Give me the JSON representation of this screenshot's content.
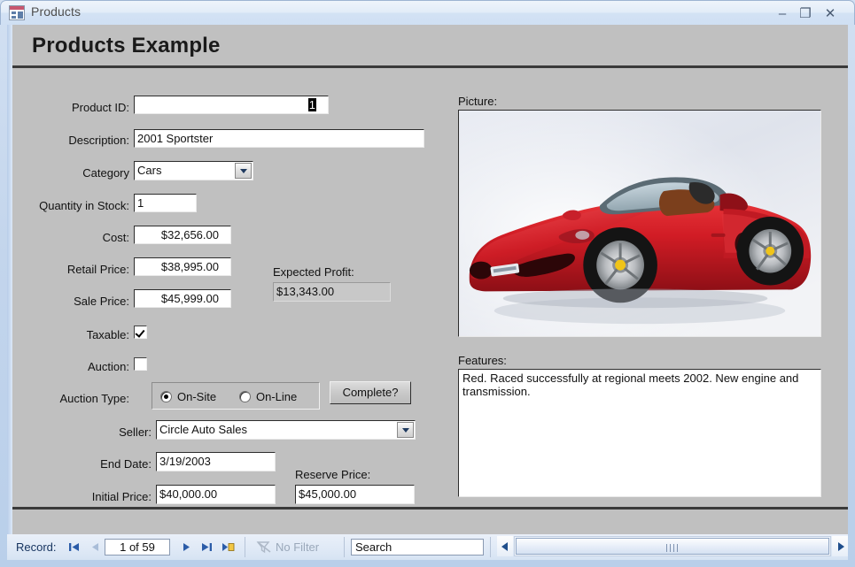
{
  "window": {
    "title": "Products",
    "icon": "access-form-icon",
    "minimize_label": "–",
    "restore_label": "❐",
    "close_label": "✕"
  },
  "form": {
    "header_title": "Products Example",
    "fields": {
      "product_id": {
        "label": "Product ID:",
        "value": "1",
        "selected": true
      },
      "description": {
        "label": "Description:",
        "value": "2001 Sportster"
      },
      "category": {
        "label": "Category",
        "value": "Cars"
      },
      "quantity_in_stock": {
        "label": "Quantity in Stock:",
        "value": "1"
      },
      "cost": {
        "label": "Cost:",
        "value": "$32,656.00"
      },
      "retail_price": {
        "label": "Retail Price:",
        "value": "$38,995.00"
      },
      "sale_price": {
        "label": "Sale Price:",
        "value": "$45,999.00"
      },
      "expected_profit": {
        "label": "Expected Profit:",
        "value": "$13,343.00"
      },
      "taxable": {
        "label": "Taxable:",
        "checked": true
      },
      "auction": {
        "label": "Auction:",
        "checked": false
      },
      "auction_type": {
        "label": "Auction Type:",
        "options": [
          "On-Site",
          "On-Line"
        ],
        "selected": "On-Site"
      },
      "complete_button": {
        "label": "Complete?"
      },
      "seller": {
        "label": "Seller:",
        "value": "Circle Auto Sales"
      },
      "end_date": {
        "label": "End Date:",
        "value": "3/19/2003"
      },
      "initial_price": {
        "label": "Initial Price:",
        "value": "$40,000.00"
      },
      "reserve_price": {
        "label": "Reserve Price:",
        "value": "$45,000.00"
      },
      "picture": {
        "label": "Picture:",
        "alt": "red-convertible-sports-car"
      },
      "features": {
        "label": "Features:",
        "value": "Red. Raced successfully at regional meets 2002. New engine and transmission."
      }
    }
  },
  "navigator": {
    "record_label": "Record:",
    "first_icon": "▮◄",
    "prev_icon": "◄",
    "position": "1 of 59",
    "next_icon": "►",
    "last_icon": "►▮",
    "new_icon": "►✱",
    "filter_label": "No Filter",
    "filter_icon": "filter-funnel-icon",
    "search_value": "Search",
    "scroll_left_icon": "◄",
    "scroll_right_icon": "►"
  },
  "colors": {
    "form_background": "#c0c0c0",
    "window_chrome": "#d3e2f4",
    "rule": "#3a3a3a",
    "nav_text": "#15325e",
    "disabled_text": "#9aa8ba"
  }
}
